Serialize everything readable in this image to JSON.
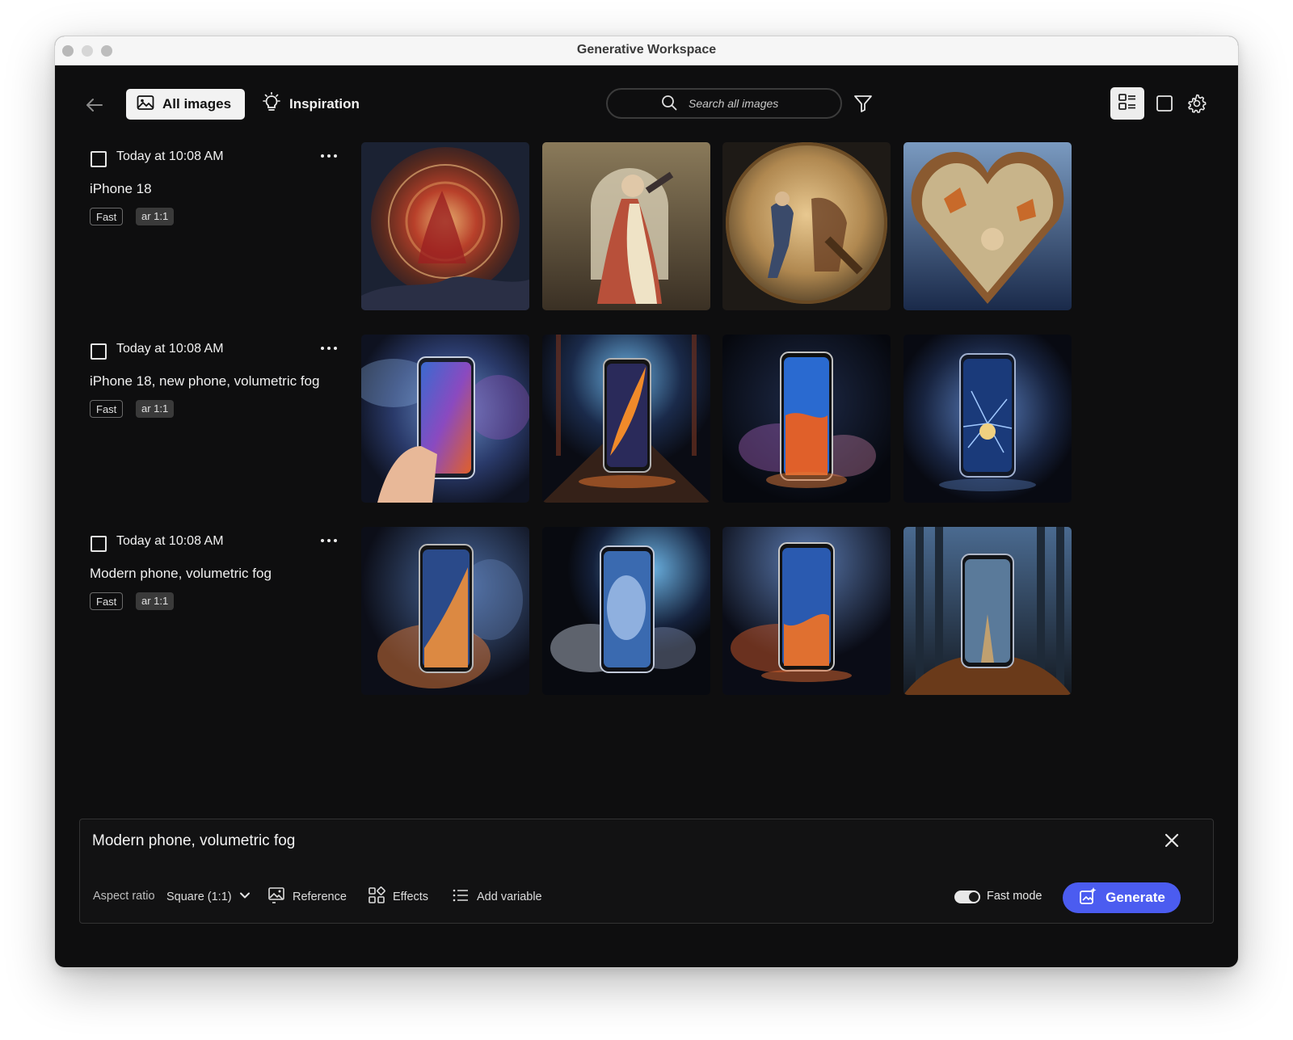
{
  "window": {
    "title": "Generative Workspace"
  },
  "toolbar": {
    "tabs": [
      {
        "label": "All images",
        "icon": "image-icon",
        "active": true
      },
      {
        "label": "Inspiration",
        "icon": "lightbulb-icon",
        "active": false
      }
    ],
    "search_placeholder": "Search all images",
    "active_view": "grid"
  },
  "batches": [
    {
      "timestamp": "Today at 10:08 AM",
      "prompt": "iPhone 18",
      "tags": [
        "Fast",
        "ar 1:1"
      ],
      "images": [
        "ornate-zodiac-wheel",
        "woman-with-mirror",
        "golden-dancers-medallion",
        "butterfly-heart"
      ]
    },
    {
      "timestamp": "Today at 10:08 AM",
      "prompt": "iPhone 18, new phone, volumetric fog",
      "tags": [
        "Fast",
        "ar 1:1"
      ],
      "images": [
        "hand-holding-phone-fog",
        "phone-fire-corridor",
        "phone-colorful-smoke",
        "phone-blue-lightning"
      ]
    },
    {
      "timestamp": "Today at 10:08 AM",
      "prompt": "Modern phone, volumetric fog",
      "tags": [
        "Fast",
        "ar 1:1"
      ],
      "images": [
        "phone-orange-fog",
        "phone-blue-clouds",
        "phone-fire-nebula",
        "phone-forest-path"
      ]
    }
  ],
  "composer": {
    "prompt_value": "Modern phone, volumetric fog",
    "aspect_ratio_label": "Aspect ratio",
    "aspect_ratio_value": "Square (1:1)",
    "reference_label": "Reference",
    "effects_label": "Effects",
    "add_variable_label": "Add variable",
    "fast_mode_label": "Fast mode",
    "fast_mode_on": true,
    "generate_label": "Generate"
  },
  "colors": {
    "accent": "#4b5cf0",
    "background": "#0e0e0f"
  }
}
